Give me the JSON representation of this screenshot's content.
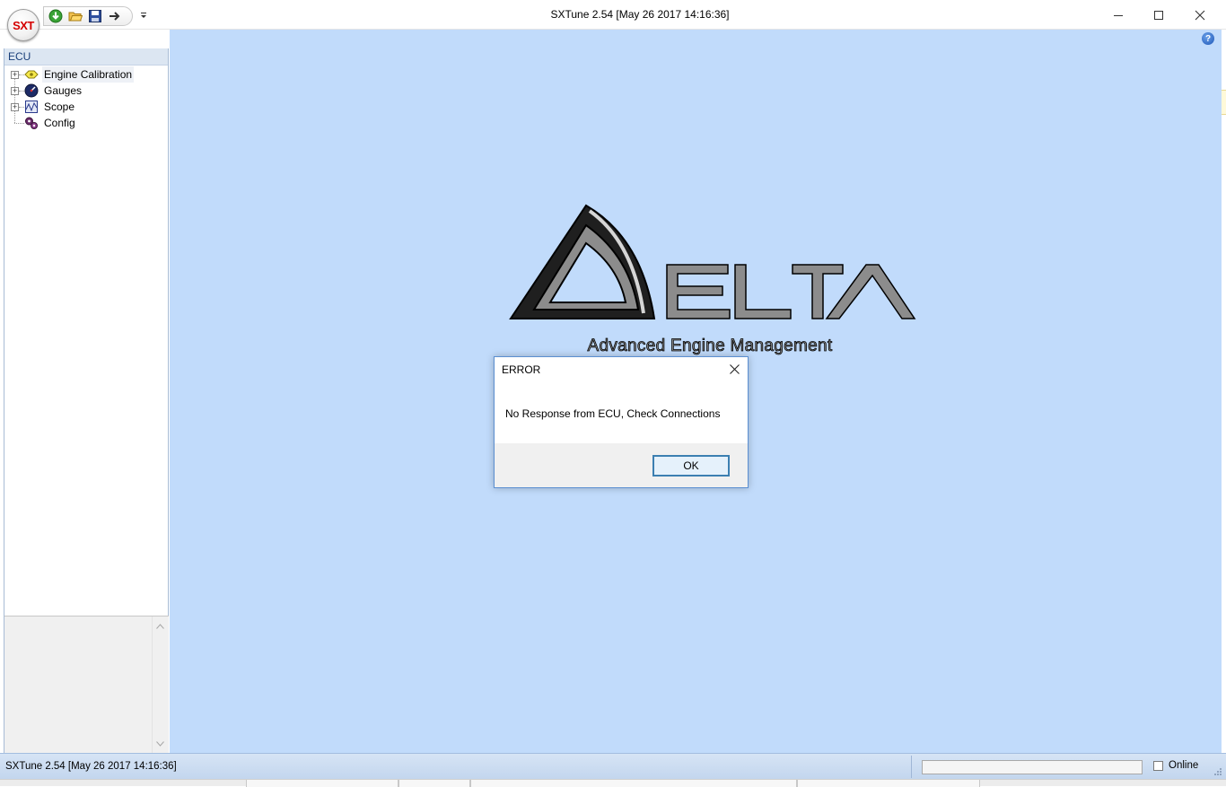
{
  "app": {
    "window_title": "SXTune 2.54 [May 26 2017 14:16:36]",
    "orb_label": "SXT"
  },
  "quick_access": {
    "items": [
      "download-icon",
      "open-folder-icon",
      "save-icon",
      "connect-arrow-icon"
    ],
    "more_icon": "customize-dropdown-icon"
  },
  "window_controls": [
    "minimize-icon",
    "maximize-icon",
    "close-icon"
  ],
  "sidebar": {
    "header": "ECU",
    "items": [
      {
        "label": "Engine Calibration",
        "icon": "engine-calibration-icon",
        "expandable": true,
        "selected": true
      },
      {
        "label": "Gauges",
        "icon": "gauge-icon",
        "expandable": true,
        "selected": false
      },
      {
        "label": "Scope",
        "icon": "scope-icon",
        "expandable": true,
        "selected": false
      },
      {
        "label": "Config",
        "icon": "config-gears-icon",
        "expandable": false,
        "selected": false
      }
    ]
  },
  "main": {
    "background": "#c1dbfb",
    "help_icon": "help-icon",
    "logo": {
      "brand": "ELTA",
      "tagline": "Advanced Engine Management"
    }
  },
  "dialog": {
    "title": "ERROR",
    "message": "No Response from ECU, Check Connections",
    "ok_label": "OK"
  },
  "statusbar": {
    "text": "SXTune 2.54 [May 26 2017 14:16:36]",
    "online_label": "Online",
    "online_checked": false,
    "progress": 0
  }
}
